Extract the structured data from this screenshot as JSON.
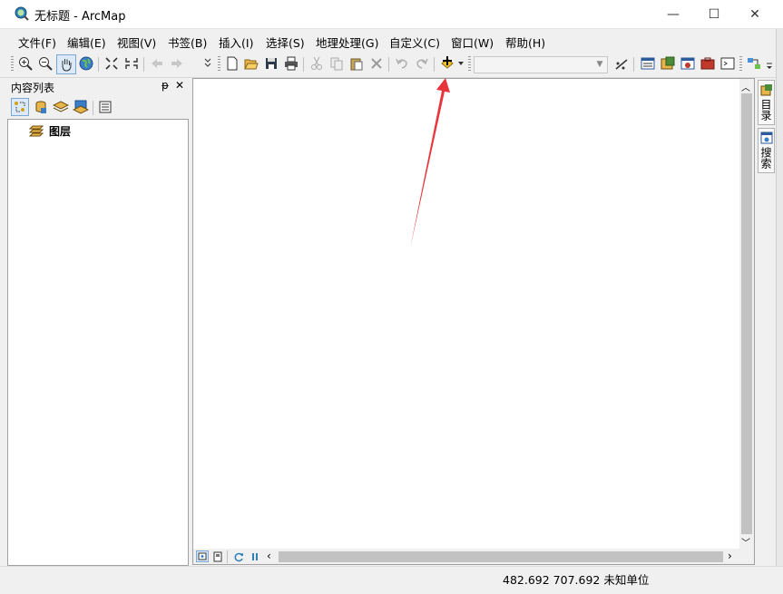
{
  "window": {
    "title": "无标题 - ArcMap",
    "minimize_glyph": "—",
    "maximize_glyph": "☐",
    "close_glyph": "✕"
  },
  "menu": [
    {
      "label": "文件(F)"
    },
    {
      "label": "编辑(E)"
    },
    {
      "label": "视图(V)"
    },
    {
      "label": "书签(B)"
    },
    {
      "label": "插入(I)"
    },
    {
      "label": "选择(S)"
    },
    {
      "label": "地理处理(G)"
    },
    {
      "label": "自定义(C)"
    },
    {
      "label": "窗口(W)"
    },
    {
      "label": "帮助(H)"
    }
  ],
  "toc": {
    "title": "内容列表",
    "pin_glyph": "ᵽ",
    "close_glyph": "✕",
    "root_layer": "图层"
  },
  "right_dock": {
    "catalog_tab": "目录",
    "search_tab": "搜索"
  },
  "status": {
    "coordinates": "482.692  707.692 未知单位"
  },
  "colors": {
    "arrow": "#e8353b",
    "titlebar_bg": "#ffffff",
    "chrome_bg": "#f0f0f0"
  },
  "icons": {
    "add_data": "add-data-icon",
    "zoom_in": "zoom-in-icon",
    "pan": "pan-hand-icon"
  }
}
